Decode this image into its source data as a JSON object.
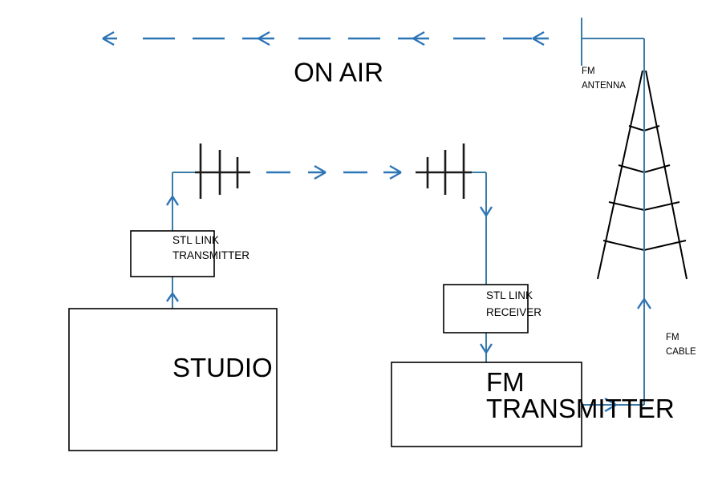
{
  "diagram": {
    "title": "ON AIR",
    "accent_color": "#2e75b6",
    "line_color": "#3a7ca5",
    "stroke_color": "#000000",
    "background_color": "#ffffff",
    "nodes": {
      "studio": {
        "label": "STUDIO"
      },
      "stl_transmitter": {
        "line1": "STL LINK",
        "line2": "TRANSMITTER"
      },
      "stl_receiver": {
        "line1": "STL LINK",
        "line2": "RECEIVER"
      },
      "fm_transmitter": {
        "line1": "FM",
        "line2": "TRANSMITTER"
      }
    },
    "annotations": {
      "fm_antenna": {
        "line1": "FM",
        "line2": "ANTENNA"
      },
      "fm_cable": {
        "line1": "FM",
        "line2": "CABLE"
      }
    }
  }
}
